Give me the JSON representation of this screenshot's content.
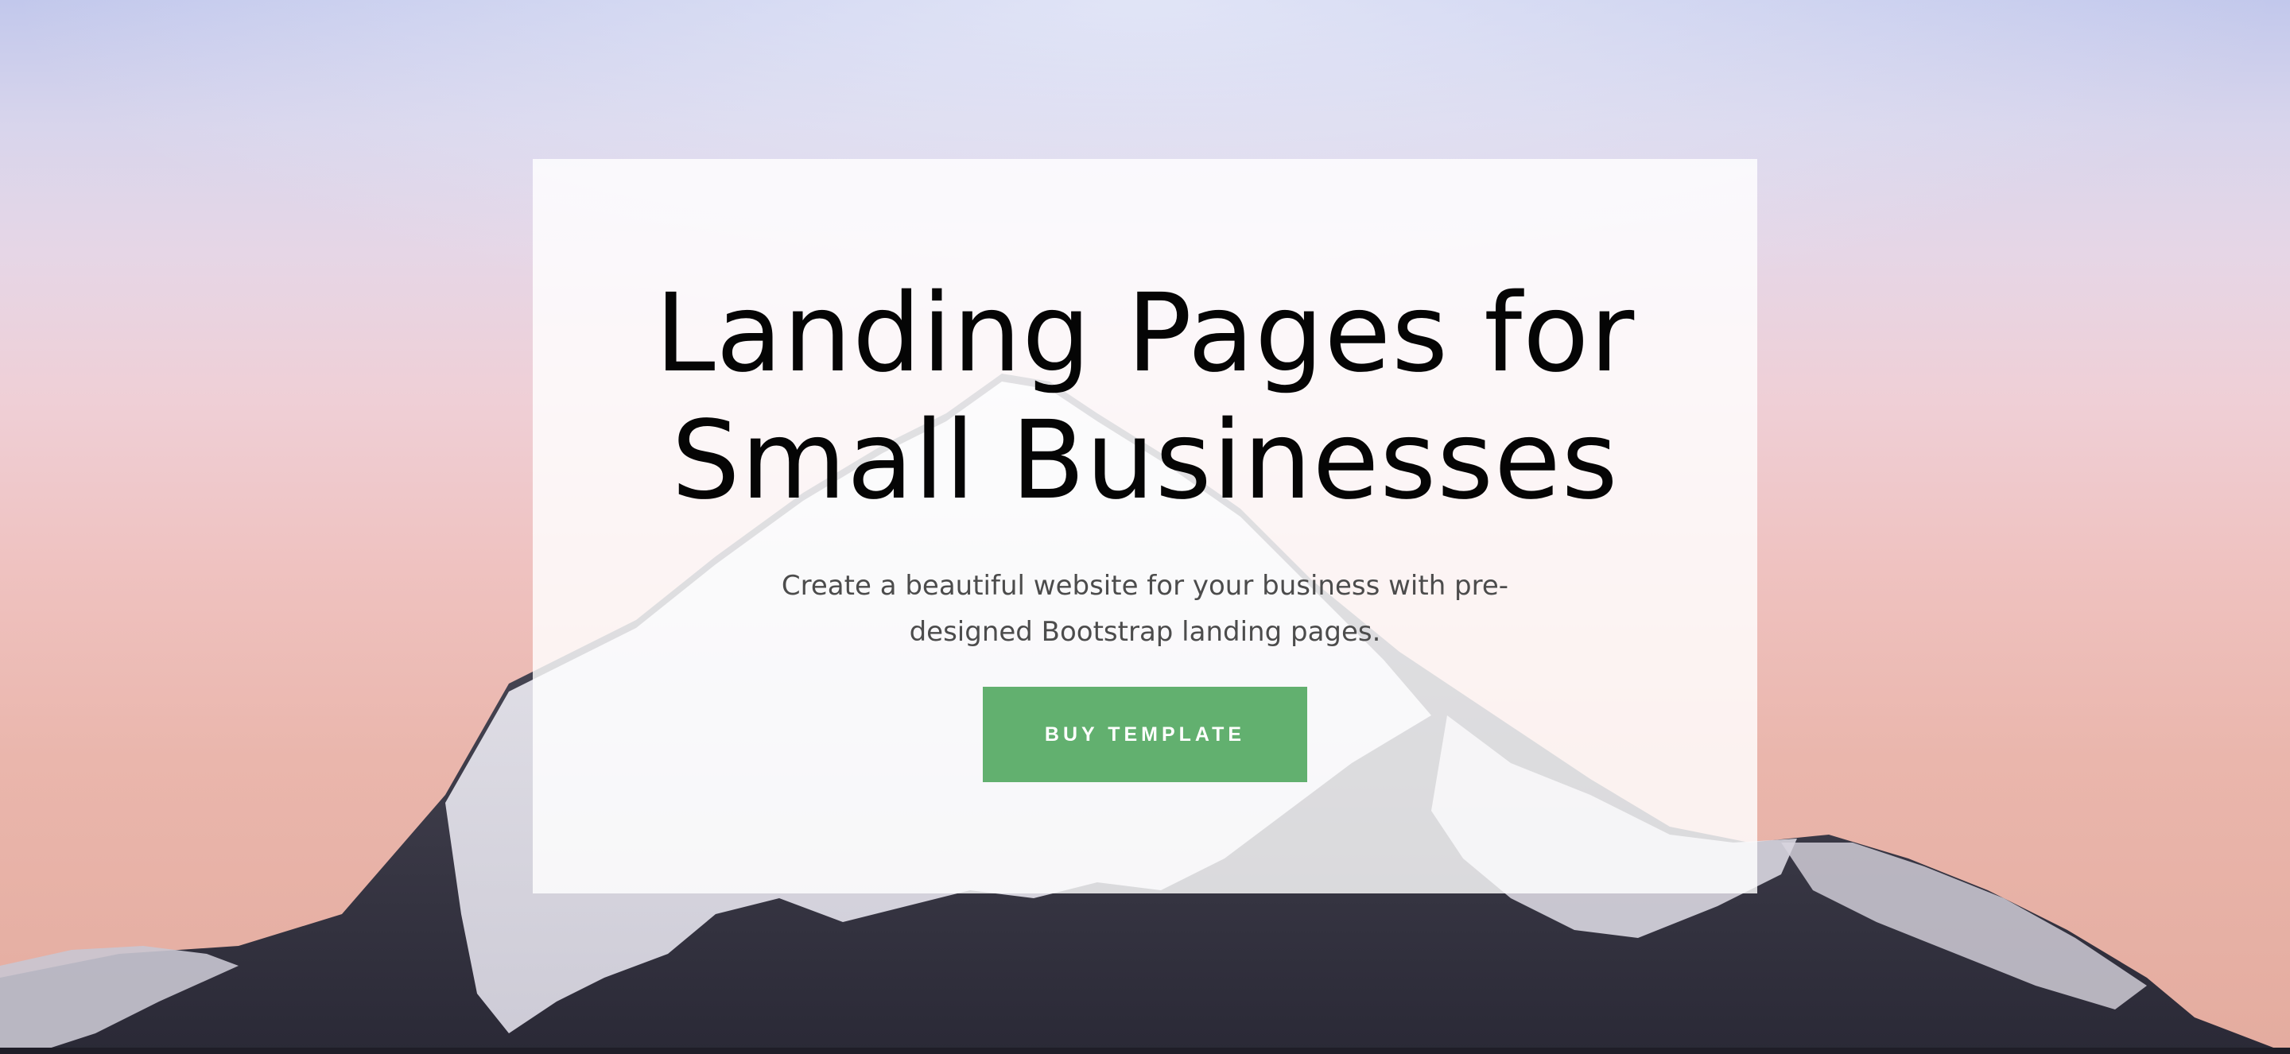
{
  "hero": {
    "title_line1": "Landing Pages for",
    "title_line2": "Small Businesses",
    "subtitle": "Create a beautiful website for your business with pre-designed Bootstrap landing pages.",
    "button_label": "BUY TEMPLATE",
    "background_image": "snow-mountain-sunset"
  },
  "colors": {
    "button": "#62b06f",
    "title": "#050505",
    "subtitle": "#4c4c4c",
    "card": "#ffffff"
  }
}
